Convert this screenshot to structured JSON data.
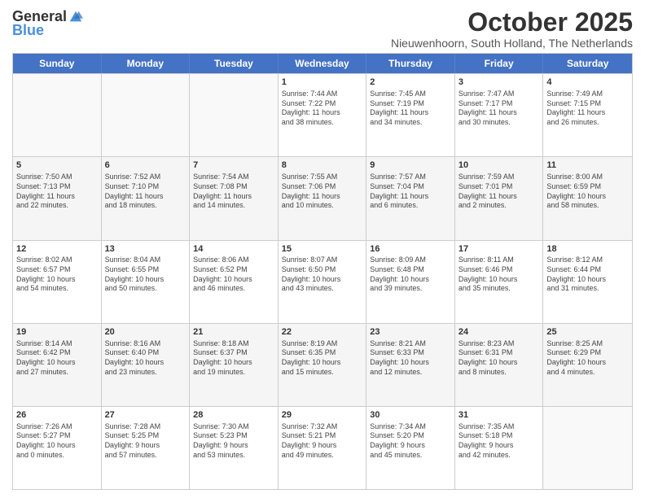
{
  "logo": {
    "general": "General",
    "blue": "Blue"
  },
  "title": "October 2025",
  "subtitle": "Nieuwenhoorn, South Holland, The Netherlands",
  "days": [
    "Sunday",
    "Monday",
    "Tuesday",
    "Wednesday",
    "Thursday",
    "Friday",
    "Saturday"
  ],
  "weeks": [
    [
      {
        "day": "",
        "info": ""
      },
      {
        "day": "",
        "info": ""
      },
      {
        "day": "",
        "info": ""
      },
      {
        "day": "1",
        "info": "Sunrise: 7:44 AM\nSunset: 7:22 PM\nDaylight: 11 hours\nand 38 minutes."
      },
      {
        "day": "2",
        "info": "Sunrise: 7:45 AM\nSunset: 7:19 PM\nDaylight: 11 hours\nand 34 minutes."
      },
      {
        "day": "3",
        "info": "Sunrise: 7:47 AM\nSunset: 7:17 PM\nDaylight: 11 hours\nand 30 minutes."
      },
      {
        "day": "4",
        "info": "Sunrise: 7:49 AM\nSunset: 7:15 PM\nDaylight: 11 hours\nand 26 minutes."
      }
    ],
    [
      {
        "day": "5",
        "info": "Sunrise: 7:50 AM\nSunset: 7:13 PM\nDaylight: 11 hours\nand 22 minutes."
      },
      {
        "day": "6",
        "info": "Sunrise: 7:52 AM\nSunset: 7:10 PM\nDaylight: 11 hours\nand 18 minutes."
      },
      {
        "day": "7",
        "info": "Sunrise: 7:54 AM\nSunset: 7:08 PM\nDaylight: 11 hours\nand 14 minutes."
      },
      {
        "day": "8",
        "info": "Sunrise: 7:55 AM\nSunset: 7:06 PM\nDaylight: 11 hours\nand 10 minutes."
      },
      {
        "day": "9",
        "info": "Sunrise: 7:57 AM\nSunset: 7:04 PM\nDaylight: 11 hours\nand 6 minutes."
      },
      {
        "day": "10",
        "info": "Sunrise: 7:59 AM\nSunset: 7:01 PM\nDaylight: 11 hours\nand 2 minutes."
      },
      {
        "day": "11",
        "info": "Sunrise: 8:00 AM\nSunset: 6:59 PM\nDaylight: 10 hours\nand 58 minutes."
      }
    ],
    [
      {
        "day": "12",
        "info": "Sunrise: 8:02 AM\nSunset: 6:57 PM\nDaylight: 10 hours\nand 54 minutes."
      },
      {
        "day": "13",
        "info": "Sunrise: 8:04 AM\nSunset: 6:55 PM\nDaylight: 10 hours\nand 50 minutes."
      },
      {
        "day": "14",
        "info": "Sunrise: 8:06 AM\nSunset: 6:52 PM\nDaylight: 10 hours\nand 46 minutes."
      },
      {
        "day": "15",
        "info": "Sunrise: 8:07 AM\nSunset: 6:50 PM\nDaylight: 10 hours\nand 43 minutes."
      },
      {
        "day": "16",
        "info": "Sunrise: 8:09 AM\nSunset: 6:48 PM\nDaylight: 10 hours\nand 39 minutes."
      },
      {
        "day": "17",
        "info": "Sunrise: 8:11 AM\nSunset: 6:46 PM\nDaylight: 10 hours\nand 35 minutes."
      },
      {
        "day": "18",
        "info": "Sunrise: 8:12 AM\nSunset: 6:44 PM\nDaylight: 10 hours\nand 31 minutes."
      }
    ],
    [
      {
        "day": "19",
        "info": "Sunrise: 8:14 AM\nSunset: 6:42 PM\nDaylight: 10 hours\nand 27 minutes."
      },
      {
        "day": "20",
        "info": "Sunrise: 8:16 AM\nSunset: 6:40 PM\nDaylight: 10 hours\nand 23 minutes."
      },
      {
        "day": "21",
        "info": "Sunrise: 8:18 AM\nSunset: 6:37 PM\nDaylight: 10 hours\nand 19 minutes."
      },
      {
        "day": "22",
        "info": "Sunrise: 8:19 AM\nSunset: 6:35 PM\nDaylight: 10 hours\nand 15 minutes."
      },
      {
        "day": "23",
        "info": "Sunrise: 8:21 AM\nSunset: 6:33 PM\nDaylight: 10 hours\nand 12 minutes."
      },
      {
        "day": "24",
        "info": "Sunrise: 8:23 AM\nSunset: 6:31 PM\nDaylight: 10 hours\nand 8 minutes."
      },
      {
        "day": "25",
        "info": "Sunrise: 8:25 AM\nSunset: 6:29 PM\nDaylight: 10 hours\nand 4 minutes."
      }
    ],
    [
      {
        "day": "26",
        "info": "Sunrise: 7:26 AM\nSunset: 5:27 PM\nDaylight: 10 hours\nand 0 minutes."
      },
      {
        "day": "27",
        "info": "Sunrise: 7:28 AM\nSunset: 5:25 PM\nDaylight: 9 hours\nand 57 minutes."
      },
      {
        "day": "28",
        "info": "Sunrise: 7:30 AM\nSunset: 5:23 PM\nDaylight: 9 hours\nand 53 minutes."
      },
      {
        "day": "29",
        "info": "Sunrise: 7:32 AM\nSunset: 5:21 PM\nDaylight: 9 hours\nand 49 minutes."
      },
      {
        "day": "30",
        "info": "Sunrise: 7:34 AM\nSunset: 5:20 PM\nDaylight: 9 hours\nand 45 minutes."
      },
      {
        "day": "31",
        "info": "Sunrise: 7:35 AM\nSunset: 5:18 PM\nDaylight: 9 hours\nand 42 minutes."
      },
      {
        "day": "",
        "info": ""
      }
    ]
  ]
}
